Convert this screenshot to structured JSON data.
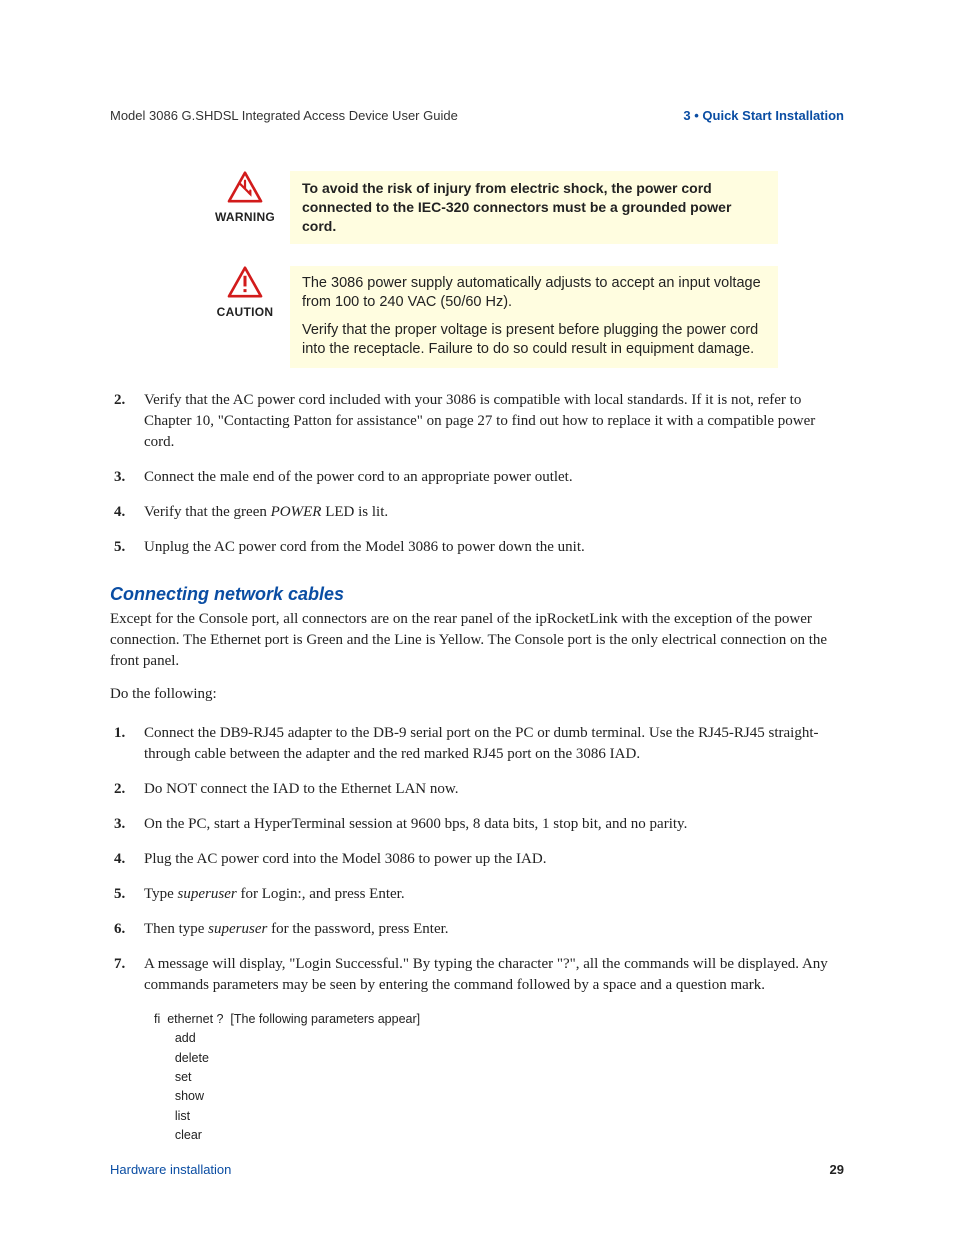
{
  "header": {
    "left": "Model 3086 G.SHDSL Integrated Access Device User Guide",
    "right": "3 • Quick Start Installation"
  },
  "warning": {
    "label": "WARNING",
    "text": "To avoid the risk of injury from electric shock, the power cord connected to the IEC-320 connectors must be a grounded power cord."
  },
  "caution": {
    "label": "CAUTION",
    "p1": "The 3086 power supply automatically adjusts to accept an input voltage from 100 to 240 VAC (50/60 Hz).",
    "p2": "Verify that the proper voltage is present before plugging the power cord into the receptacle. Failure to do so could result in equipment damage."
  },
  "steps_a": [
    "Verify that the AC power cord included with your 3086 is compatible with local standards. If it is not, refer to Chapter 10, \"Contacting Patton for assistance\" on page 27 to find out how to replace it with a compatible power cord.",
    "Connect the male end of the power cord to an appropriate power outlet.",
    "Verify that the green POWER LED is lit.",
    "Unplug the AC power cord from the Model 3086 to power down the unit."
  ],
  "section": {
    "title": "Connecting network cables",
    "intro": "Except for the Console port, all connectors are on the rear panel of the ipRocketLink with the exception of the power connection. The Ethernet port is Green and the Line is Yellow. The Console port is the only electrical connection on the front panel.",
    "lead": "Do the following:"
  },
  "steps_b": [
    "Connect the DB9-RJ45 adapter to the DB-9 serial port on the PC or dumb terminal. Use the RJ45-RJ45 straight-through cable between the adapter and the red marked RJ45 port on the 3086 IAD.",
    "Do NOT connect the IAD to the Ethernet LAN now.",
    "On the PC, start a HyperTerminal session at 9600 bps, 8 data bits, 1 stop bit, and no parity.",
    "Plug the AC power cord into the Model 3086 to power up the IAD.",
    "Type superuser for Login:, and press Enter.",
    "Then type superuser for the password, press Enter.",
    "A message will display, \"Login Successful.\"  By typing the character \"?\", all the commands will be displayed. Any commands parameters may be seen by entering the command followed by a space and a question mark."
  ],
  "code": "fi  ethernet ?  [The following parameters appear]\n      add\n      delete\n      set\n      show\n      list\n      clear",
  "footer": {
    "left": "Hardware installation",
    "page": "29"
  }
}
